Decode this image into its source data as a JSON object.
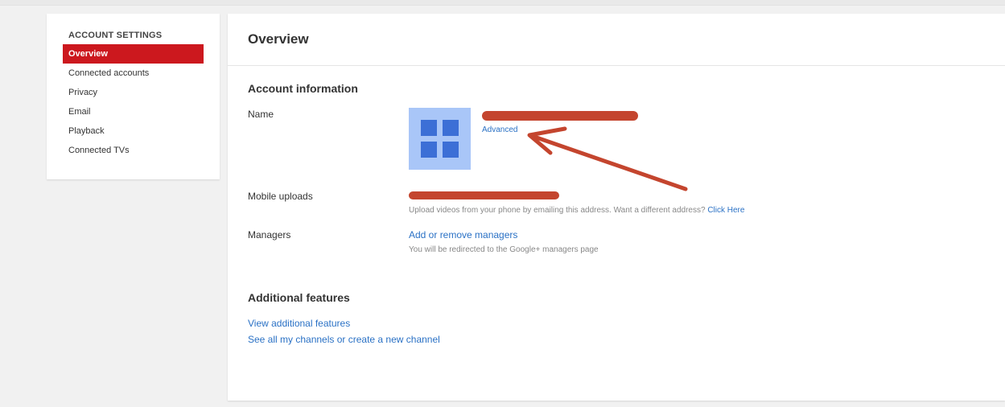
{
  "sidebar": {
    "heading": "ACCOUNT SETTINGS",
    "items": [
      {
        "label": "Overview",
        "active": true
      },
      {
        "label": "Connected accounts"
      },
      {
        "label": "Privacy"
      },
      {
        "label": "Email"
      },
      {
        "label": "Playback"
      },
      {
        "label": "Connected TVs"
      }
    ]
  },
  "main": {
    "title": "Overview",
    "account_info": {
      "heading": "Account information",
      "name_label": "Name",
      "advanced_link": "Advanced",
      "mobile_uploads_label": "Mobile uploads",
      "mobile_uploads_note": "Upload videos from your phone by emailing this address. Want a different address?",
      "click_here_link": "Click Here",
      "managers_label": "Managers",
      "managers_link": "Add or remove managers",
      "managers_note": "You will be redirected to the Google+ managers page"
    },
    "additional": {
      "heading": "Additional features",
      "view_features_link": "View additional features",
      "channels_link": "See all my channels or create a new channel"
    }
  },
  "colors": {
    "accent": "#cc181e",
    "link": "#2a71c5",
    "annotation": "#c4452e",
    "avatar_bg": "#a9c6f8",
    "avatar_fg": "#3c6fd6"
  },
  "icons": {
    "avatar": "google-plus-page-avatar-icon",
    "annotation": "red-arrow-annotation"
  }
}
